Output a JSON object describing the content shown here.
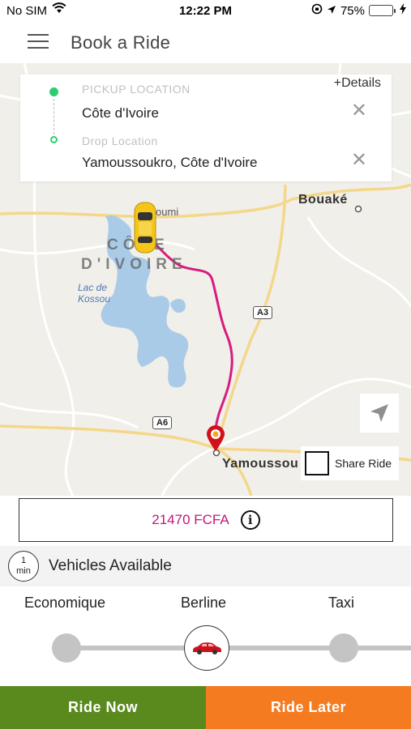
{
  "status_bar": {
    "carrier": "No SIM",
    "time": "12:22 PM",
    "battery_percent": "75%",
    "battery_level": 0.75
  },
  "header": {
    "title": "Book a Ride"
  },
  "location_card": {
    "pickup_label": "PICKUP LOCATION",
    "pickup_value": "Côte d'Ivoire",
    "drop_label": "Drop Location",
    "drop_value": "Yamoussoukro, Côte d'Ivoire",
    "details_link": "+Details",
    "clear_glyph": "✕"
  },
  "map": {
    "labels": {
      "bouake": "Bouaké",
      "bouafle": "oumi",
      "country_line1": "CÔTE",
      "country_line2": "D'IVOIRE",
      "lake": "Lac de\nKossou",
      "yamoussoukro": "Yamoussou"
    },
    "road_shields": {
      "a3": "A3",
      "a6": "A6"
    },
    "route_color": "#d81b7f"
  },
  "share_ride": {
    "label": "Share Ride"
  },
  "fare": {
    "amount": "21470 FCFA",
    "info_glyph": "i",
    "color": "#c2187b"
  },
  "availability": {
    "eta_value": "1",
    "eta_unit": "min",
    "text": "Vehicles Available"
  },
  "vehicles": {
    "options": [
      "Economique",
      "Berline",
      "Taxi"
    ],
    "selected": "Berline"
  },
  "actions": {
    "ride_now": "Ride Now",
    "ride_later": "Ride Later",
    "ride_now_color": "#5a8a1e",
    "ride_later_color": "#f47b1f"
  }
}
